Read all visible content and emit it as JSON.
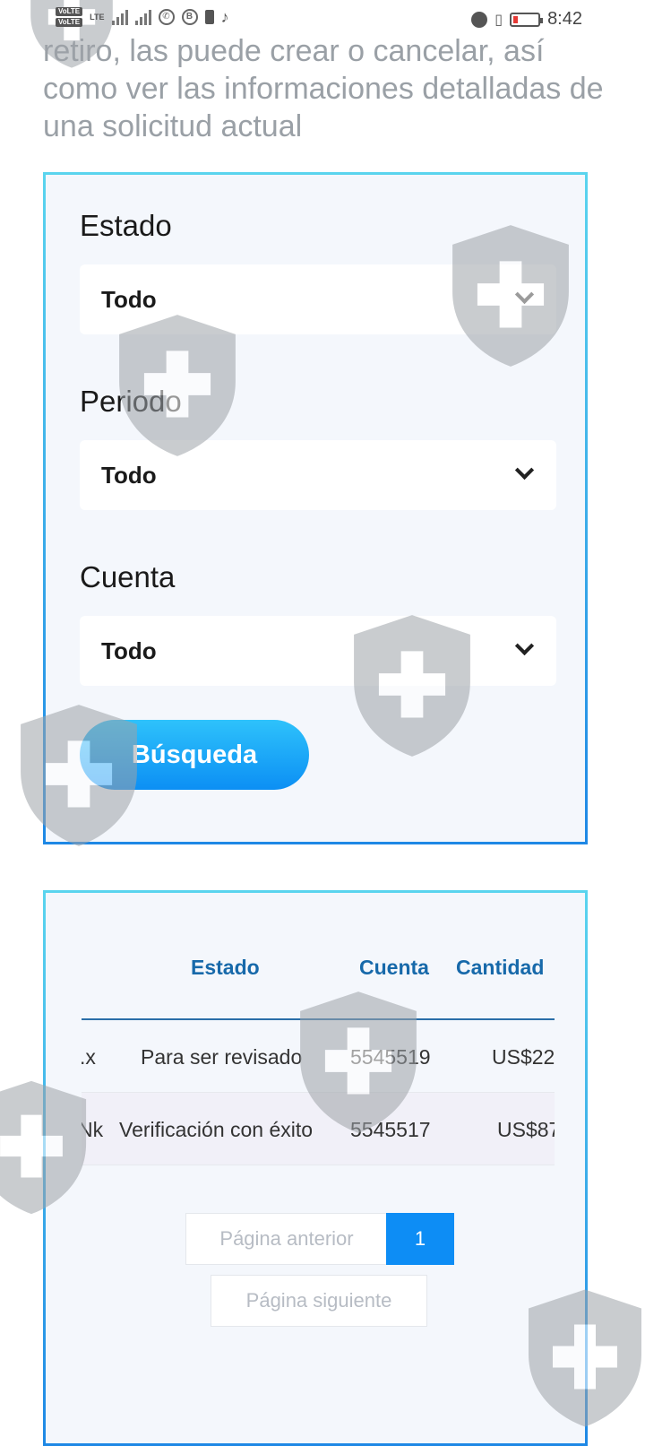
{
  "status_bar": {
    "network_badges": [
      "VoLTE",
      "VoLTE"
    ],
    "network_type": "LTE",
    "time": "8:42",
    "icons": [
      "whatsapp-icon",
      "b-app-icon",
      "notification-icon",
      "tiktok-icon",
      "alarm-icon",
      "vibrate-icon",
      "battery-low-icon"
    ],
    "battery_color": "#e53935"
  },
  "intro_text": "retiro, las puede crear o cancelar, así como ver las informaciones detalladas de una solicitud actual",
  "filters": {
    "estado": {
      "label": "Estado",
      "value": "Todo"
    },
    "periodo": {
      "label": "Periodo",
      "value": "Todo"
    },
    "cuenta": {
      "label": "Cuenta",
      "value": "Todo"
    },
    "search_button": "Búsqueda"
  },
  "table": {
    "headers": {
      "estado": "Estado",
      "cuenta": "Cuenta",
      "cantidad": "Cantidad"
    },
    "rows": [
      {
        "id_fragment": ".x",
        "estado": "Para ser revisado",
        "cuenta": "5545519",
        "cantidad": "US$22"
      },
      {
        "id_fragment": "Nk",
        "estado": "Verificación con éxito",
        "cuenta": "5545517",
        "cantidad": "US$87"
      }
    ]
  },
  "pagination": {
    "prev": "Página anterior",
    "current": "1",
    "next": "Página siguiente"
  },
  "colors": {
    "accent": "#0d8df5",
    "header_text": "#1769aa",
    "panel_bg": "#f4f7fc",
    "border_top": "#5ad4ee",
    "border_bottom": "#1e88e5"
  }
}
